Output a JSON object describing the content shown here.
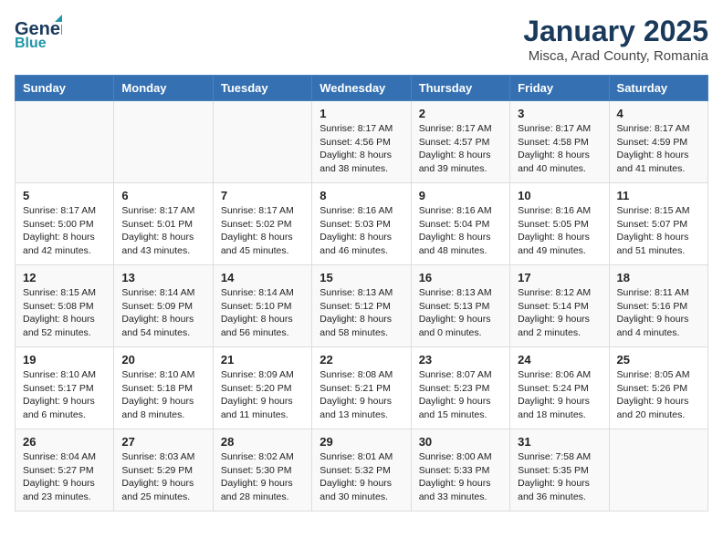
{
  "header": {
    "logo_line1": "General",
    "logo_line2": "Blue",
    "title": "January 2025",
    "subtitle": "Misca, Arad County, Romania"
  },
  "days_of_week": [
    "Sunday",
    "Monday",
    "Tuesday",
    "Wednesday",
    "Thursday",
    "Friday",
    "Saturday"
  ],
  "weeks": [
    [
      {
        "day": "",
        "info": ""
      },
      {
        "day": "",
        "info": ""
      },
      {
        "day": "",
        "info": ""
      },
      {
        "day": "1",
        "info": "Sunrise: 8:17 AM\nSunset: 4:56 PM\nDaylight: 8 hours\nand 38 minutes."
      },
      {
        "day": "2",
        "info": "Sunrise: 8:17 AM\nSunset: 4:57 PM\nDaylight: 8 hours\nand 39 minutes."
      },
      {
        "day": "3",
        "info": "Sunrise: 8:17 AM\nSunset: 4:58 PM\nDaylight: 8 hours\nand 40 minutes."
      },
      {
        "day": "4",
        "info": "Sunrise: 8:17 AM\nSunset: 4:59 PM\nDaylight: 8 hours\nand 41 minutes."
      }
    ],
    [
      {
        "day": "5",
        "info": "Sunrise: 8:17 AM\nSunset: 5:00 PM\nDaylight: 8 hours\nand 42 minutes."
      },
      {
        "day": "6",
        "info": "Sunrise: 8:17 AM\nSunset: 5:01 PM\nDaylight: 8 hours\nand 43 minutes."
      },
      {
        "day": "7",
        "info": "Sunrise: 8:17 AM\nSunset: 5:02 PM\nDaylight: 8 hours\nand 45 minutes."
      },
      {
        "day": "8",
        "info": "Sunrise: 8:16 AM\nSunset: 5:03 PM\nDaylight: 8 hours\nand 46 minutes."
      },
      {
        "day": "9",
        "info": "Sunrise: 8:16 AM\nSunset: 5:04 PM\nDaylight: 8 hours\nand 48 minutes."
      },
      {
        "day": "10",
        "info": "Sunrise: 8:16 AM\nSunset: 5:05 PM\nDaylight: 8 hours\nand 49 minutes."
      },
      {
        "day": "11",
        "info": "Sunrise: 8:15 AM\nSunset: 5:07 PM\nDaylight: 8 hours\nand 51 minutes."
      }
    ],
    [
      {
        "day": "12",
        "info": "Sunrise: 8:15 AM\nSunset: 5:08 PM\nDaylight: 8 hours\nand 52 minutes."
      },
      {
        "day": "13",
        "info": "Sunrise: 8:14 AM\nSunset: 5:09 PM\nDaylight: 8 hours\nand 54 minutes."
      },
      {
        "day": "14",
        "info": "Sunrise: 8:14 AM\nSunset: 5:10 PM\nDaylight: 8 hours\nand 56 minutes."
      },
      {
        "day": "15",
        "info": "Sunrise: 8:13 AM\nSunset: 5:12 PM\nDaylight: 8 hours\nand 58 minutes."
      },
      {
        "day": "16",
        "info": "Sunrise: 8:13 AM\nSunset: 5:13 PM\nDaylight: 9 hours\nand 0 minutes."
      },
      {
        "day": "17",
        "info": "Sunrise: 8:12 AM\nSunset: 5:14 PM\nDaylight: 9 hours\nand 2 minutes."
      },
      {
        "day": "18",
        "info": "Sunrise: 8:11 AM\nSunset: 5:16 PM\nDaylight: 9 hours\nand 4 minutes."
      }
    ],
    [
      {
        "day": "19",
        "info": "Sunrise: 8:10 AM\nSunset: 5:17 PM\nDaylight: 9 hours\nand 6 minutes."
      },
      {
        "day": "20",
        "info": "Sunrise: 8:10 AM\nSunset: 5:18 PM\nDaylight: 9 hours\nand 8 minutes."
      },
      {
        "day": "21",
        "info": "Sunrise: 8:09 AM\nSunset: 5:20 PM\nDaylight: 9 hours\nand 11 minutes."
      },
      {
        "day": "22",
        "info": "Sunrise: 8:08 AM\nSunset: 5:21 PM\nDaylight: 9 hours\nand 13 minutes."
      },
      {
        "day": "23",
        "info": "Sunrise: 8:07 AM\nSunset: 5:23 PM\nDaylight: 9 hours\nand 15 minutes."
      },
      {
        "day": "24",
        "info": "Sunrise: 8:06 AM\nSunset: 5:24 PM\nDaylight: 9 hours\nand 18 minutes."
      },
      {
        "day": "25",
        "info": "Sunrise: 8:05 AM\nSunset: 5:26 PM\nDaylight: 9 hours\nand 20 minutes."
      }
    ],
    [
      {
        "day": "26",
        "info": "Sunrise: 8:04 AM\nSunset: 5:27 PM\nDaylight: 9 hours\nand 23 minutes."
      },
      {
        "day": "27",
        "info": "Sunrise: 8:03 AM\nSunset: 5:29 PM\nDaylight: 9 hours\nand 25 minutes."
      },
      {
        "day": "28",
        "info": "Sunrise: 8:02 AM\nSunset: 5:30 PM\nDaylight: 9 hours\nand 28 minutes."
      },
      {
        "day": "29",
        "info": "Sunrise: 8:01 AM\nSunset: 5:32 PM\nDaylight: 9 hours\nand 30 minutes."
      },
      {
        "day": "30",
        "info": "Sunrise: 8:00 AM\nSunset: 5:33 PM\nDaylight: 9 hours\nand 33 minutes."
      },
      {
        "day": "31",
        "info": "Sunrise: 7:58 AM\nSunset: 5:35 PM\nDaylight: 9 hours\nand 36 minutes."
      },
      {
        "day": "",
        "info": ""
      }
    ]
  ]
}
